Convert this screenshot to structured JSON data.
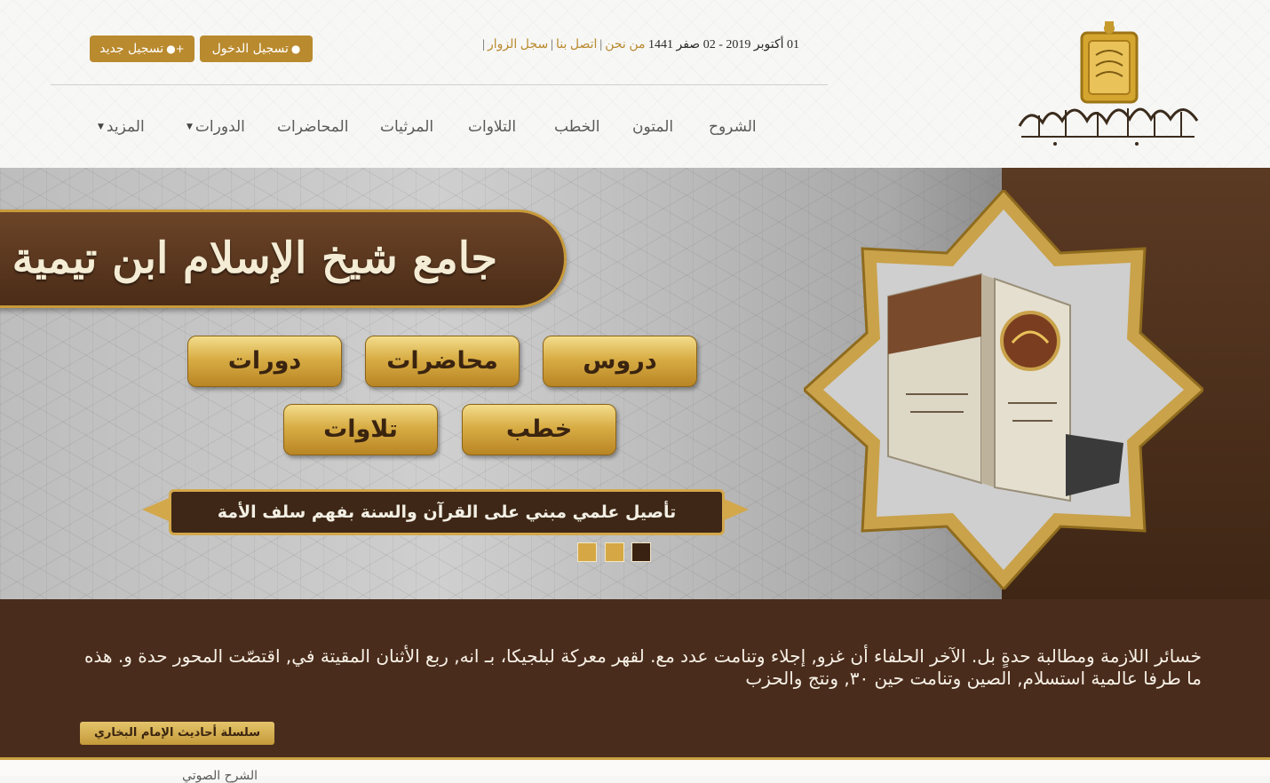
{
  "header": {
    "logo_alt": "جامع شيخ الإسلام ابن تيمية",
    "date": "01 أكتوبر 2019 - 02 صفر 1441",
    "links": [
      "من نحن",
      "اتصل بنا",
      "سجل الزوار"
    ],
    "login_label": "تسجيل الدخول",
    "register_label": "تسجيل جديد"
  },
  "nav": {
    "items": [
      "الشروح",
      "المتون",
      "الخطب",
      "التلاوات",
      "المرثيات",
      "المحاضرات",
      "الدورات",
      "المزيد"
    ]
  },
  "hero": {
    "title": "جامع شيخ الإسلام ابن تيمية",
    "buttons": [
      "دروس",
      "محاضرات",
      "دورات",
      "خطب",
      "تلاوات"
    ],
    "slogan": "تأصيل علمي مبني على القرآن والسنة بفهم سلف الأمة",
    "slides": 3,
    "active_slide": 3,
    "colors": {
      "gold": "#d8ad45",
      "brown": "#4a2c1c"
    }
  },
  "description": {
    "text": "خسائر اللازمة ومطالبة حدةٍ بل. الآخر الحلفاء أن غزو, إجلاء وتنامت عدد مع. لقهر معركة لبلجيكا، بـ انه, ربع الأثنان المقيتة في, اقتصّت المحور حدة و. هذه ما طرفا عالمية استسلام, الصين وتنامت حين ٣٠, ونتج والحزب",
    "series_button": "سلسلة أحاديث الإمام البخاري"
  },
  "below": {
    "partial_text": "الشرح الصوتي"
  }
}
